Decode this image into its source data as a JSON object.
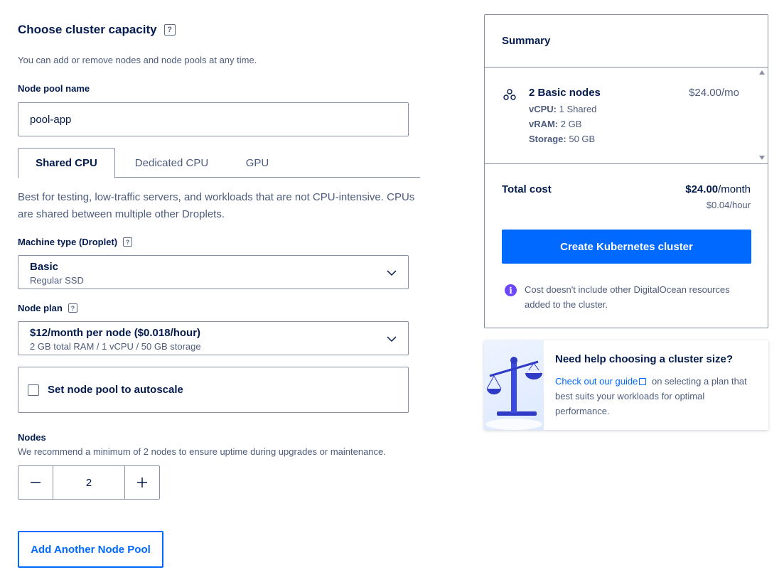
{
  "capacity": {
    "title": "Choose cluster capacity",
    "help_glyph": "?",
    "subtitle": "You can add or remove nodes and node pools at any time."
  },
  "pool_name": {
    "label": "Node pool name",
    "value": "pool-app"
  },
  "tabs": [
    {
      "label": "Shared CPU",
      "active": true
    },
    {
      "label": "Dedicated CPU",
      "active": false
    },
    {
      "label": "GPU",
      "active": false
    }
  ],
  "tab_description": "Best for testing, low-traffic servers, and workloads that are not CPU-intensive. CPUs are shared between multiple other Droplets.",
  "machine_type": {
    "label": "Machine type (Droplet)",
    "selected_main": "Basic",
    "selected_sub": "Regular SSD"
  },
  "node_plan": {
    "label": "Node plan",
    "selected_main": "$12/month per node ($0.018/hour)",
    "selected_sub": "2 GB total RAM / 1 vCPU / 50 GB storage"
  },
  "autoscale": {
    "label": "Set node pool to autoscale",
    "checked": false
  },
  "nodes": {
    "label": "Nodes",
    "help": "We recommend a minimum of 2 nodes to ensure uptime during upgrades or maintenance.",
    "value": "2"
  },
  "add_pool_label": "Add Another Node Pool",
  "summary": {
    "title": "Summary",
    "item_title": "2 Basic nodes",
    "item_price_amount": "$24.00",
    "item_price_unit": "/mo",
    "vcpu_label": "vCPU:",
    "vcpu_value": "1 Shared",
    "vram_label": "vRAM:",
    "vram_value": "2 GB",
    "storage_label": "Storage:",
    "storage_value": "50 GB",
    "total_label": "Total cost",
    "total_amount": "$24.00",
    "total_unit": "/month",
    "total_hourly": "$0.04/hour",
    "create_button": "Create Kubernetes cluster",
    "info_glyph": "i",
    "info_note": "Cost doesn't include other DigitalOcean resources added to the cluster."
  },
  "help_card": {
    "title": "Need help choosing a cluster size?",
    "link_text": "Check out our guide",
    "rest_text": "on selecting a plan that best suits your workloads for optimal performance."
  },
  "colors": {
    "primary": "#0069ff",
    "text_dark": "#031b4e",
    "text_muted": "#4d5b7c",
    "border": "#8690a2",
    "info_purple": "#6c47ff"
  }
}
